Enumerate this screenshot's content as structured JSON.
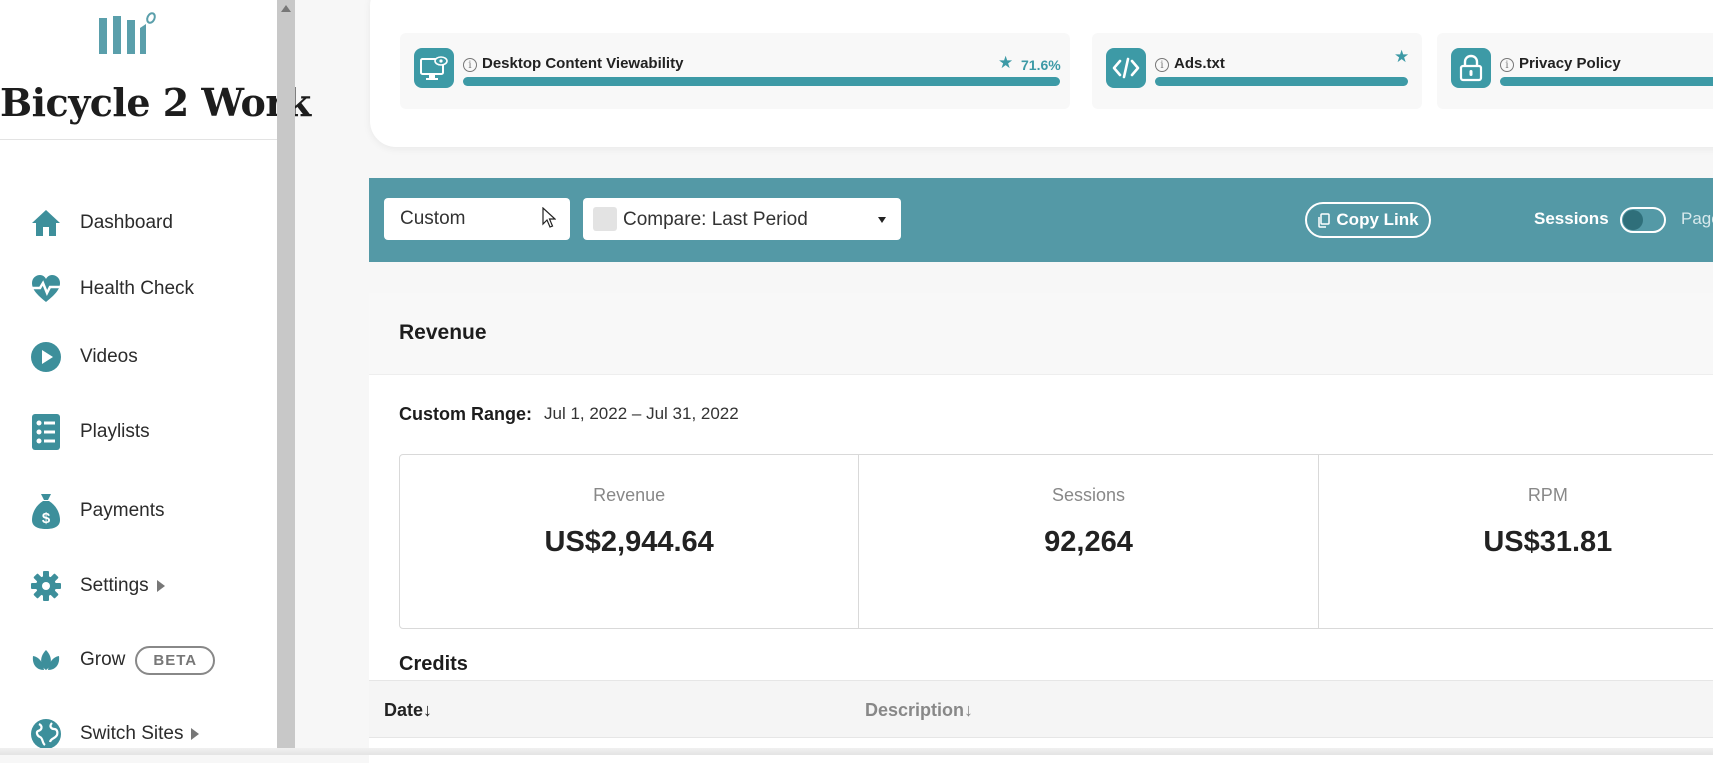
{
  "sidebar": {
    "brand": "Bicycle 2 Work",
    "items": [
      {
        "label": "Dashboard",
        "icon": "home-icon"
      },
      {
        "label": "Health Check",
        "icon": "heart-pulse-icon"
      },
      {
        "label": "Videos",
        "icon": "play-circle-icon"
      },
      {
        "label": "Playlists",
        "icon": "list-icon"
      },
      {
        "label": "Payments",
        "icon": "money-bag-icon"
      },
      {
        "label": "Settings",
        "icon": "gear-icon"
      },
      {
        "label": "Grow",
        "icon": "leaf-icon",
        "badge": "BETA"
      },
      {
        "label": "Switch Sites",
        "icon": "globe-icon"
      }
    ]
  },
  "health_tiles": [
    {
      "title": "Desktop Content Viewability",
      "value": "71.6%",
      "icon": "monitor-eye-icon"
    },
    {
      "title": "Ads.txt",
      "icon": "code-icon"
    },
    {
      "title": "Privacy Policy",
      "icon": "lock-icon"
    }
  ],
  "filters": {
    "range_select": "Custom",
    "compare_select": "Compare: Last Period",
    "copy_link": "Copy Link",
    "toggle_left": "Sessions",
    "toggle_right": "Pageviews"
  },
  "revenue": {
    "title": "Revenue",
    "range_label": "Custom Range:",
    "range_value": "Jul 1, 2022 – Jul 31, 2022",
    "stats": [
      {
        "label": "Revenue",
        "value": "US$2,944.64"
      },
      {
        "label": "Sessions",
        "value": "92,264"
      },
      {
        "label": "RPM",
        "value": "US$31.81"
      }
    ]
  },
  "credits": {
    "title": "Credits",
    "columns": [
      "Date↓",
      "Description↓"
    ]
  },
  "colors": {
    "accent": "#3d9aa6",
    "filter_bar": "#5499a6"
  }
}
